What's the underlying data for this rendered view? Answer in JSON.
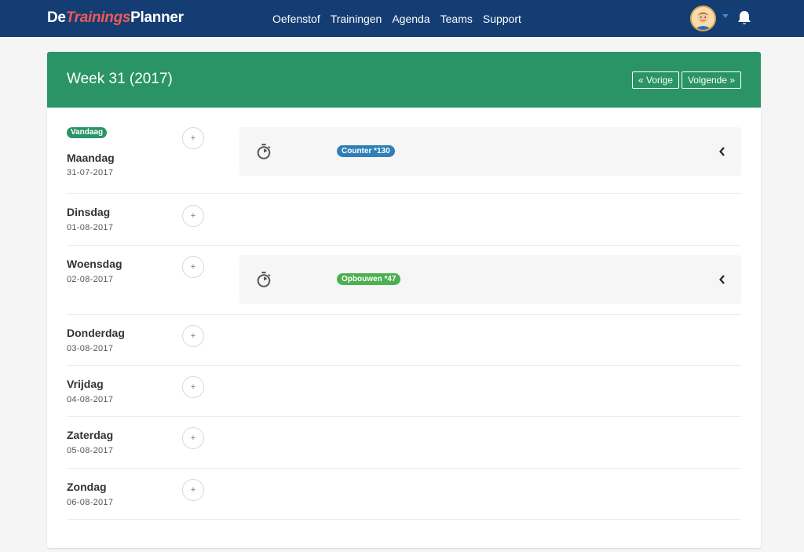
{
  "brand": {
    "part1": "De",
    "part2": "Trainings",
    "part3": "Planner"
  },
  "nav": [
    "Oefenstof",
    "Trainingen",
    "Agenda",
    "Teams",
    "Support"
  ],
  "header": {
    "title": "Week 31 (2017)",
    "prev_label": "« Vorige",
    "next_label": "Volgende »"
  },
  "today_label": "Vandaag",
  "days": [
    {
      "name": "Maandag",
      "date": "31-07-2017",
      "add": "+"
    },
    {
      "name": "Dinsdag",
      "date": "01-08-2017",
      "add": "+"
    },
    {
      "name": "Woensdag",
      "date": "02-08-2017",
      "add": "+"
    },
    {
      "name": "Donderdag",
      "date": "03-08-2017",
      "add": "+"
    },
    {
      "name": "Vrijdag",
      "date": "04-08-2017",
      "add": "+"
    },
    {
      "name": "Zaterdag",
      "date": "05-08-2017",
      "add": "+"
    },
    {
      "name": "Zondag",
      "date": "06-08-2017",
      "add": "+"
    }
  ],
  "trainings": [
    {
      "label": "Counter *130",
      "color": "#2f7fb8",
      "icons": [
        "stopwatch-icon",
        "chevron-left-icon"
      ]
    },
    {
      "label": "Opbouwen *47",
      "color": "#4cb050",
      "icons": [
        "stopwatch-icon",
        "chevron-left-icon"
      ]
    }
  ],
  "colors": {
    "navbar": "#133d73",
    "header": "#2a9467",
    "brand_accent": "#ef5a5a"
  },
  "icons": {
    "avatar": "user-avatar",
    "notifications": "bell-icon",
    "menu": "caret-down-icon"
  }
}
